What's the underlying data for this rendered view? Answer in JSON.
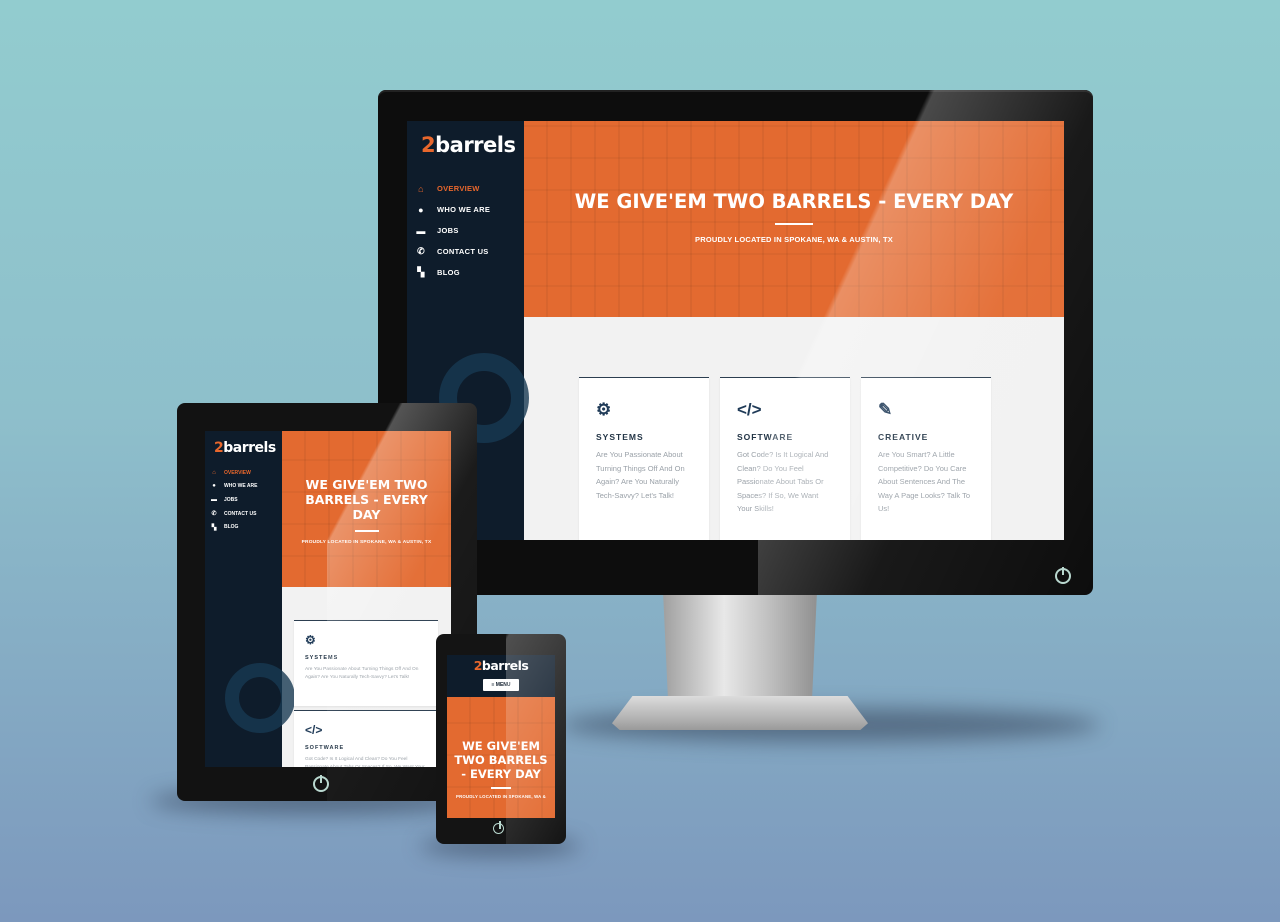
{
  "site": {
    "logo_num": "2",
    "logo_word": "barrels",
    "nav": [
      {
        "label": "OVERVIEW",
        "icon": "home-icon",
        "glyph": "⌂"
      },
      {
        "label": "WHO WE ARE",
        "icon": "user-icon",
        "glyph": "●"
      },
      {
        "label": "JOBS",
        "icon": "briefcase-icon",
        "glyph": "▬"
      },
      {
        "label": "CONTACT US",
        "icon": "phone-icon",
        "glyph": "✆"
      },
      {
        "label": "BLOG",
        "icon": "blog-icon",
        "glyph": "▚"
      }
    ],
    "hero_title": "WE GIVE'EM TWO BARRELS - EVERY DAY",
    "hero_subtitle": "PROUDLY LOCATED IN SPOKANE, WA & AUSTIN, TX",
    "phone_hero_subtitle": "PROUDLY LOCATED IN SPOKANE, WA &",
    "menu_label": "≡ MENU",
    "cards": [
      {
        "title": "SYSTEMS",
        "icon": "gear-icon",
        "glyph": "⚙",
        "text": "Are You Passionate About Turning Things Off And On Again? Are You Naturally Tech-Savvy? Let's Talk!"
      },
      {
        "title": "SOFTWARE",
        "icon": "code-icon",
        "glyph": "</>",
        "text": "Got Code? Is It Logical And Clean? Do You Feel Passionate About Tabs Or Spaces? If So, We Want Your Skills!"
      },
      {
        "title": "CREATIVE",
        "icon": "pencil-icon",
        "glyph": "✎",
        "text": "Are You Smart? A Little Competitive? Do You Care About Sentences And The Way A Page Looks? Talk To Us!"
      }
    ]
  },
  "colors": {
    "accent": "#e36a30",
    "sidebar": "#0e1c2b",
    "background_top": "#92cccf",
    "background_bottom": "#7c98bd"
  }
}
